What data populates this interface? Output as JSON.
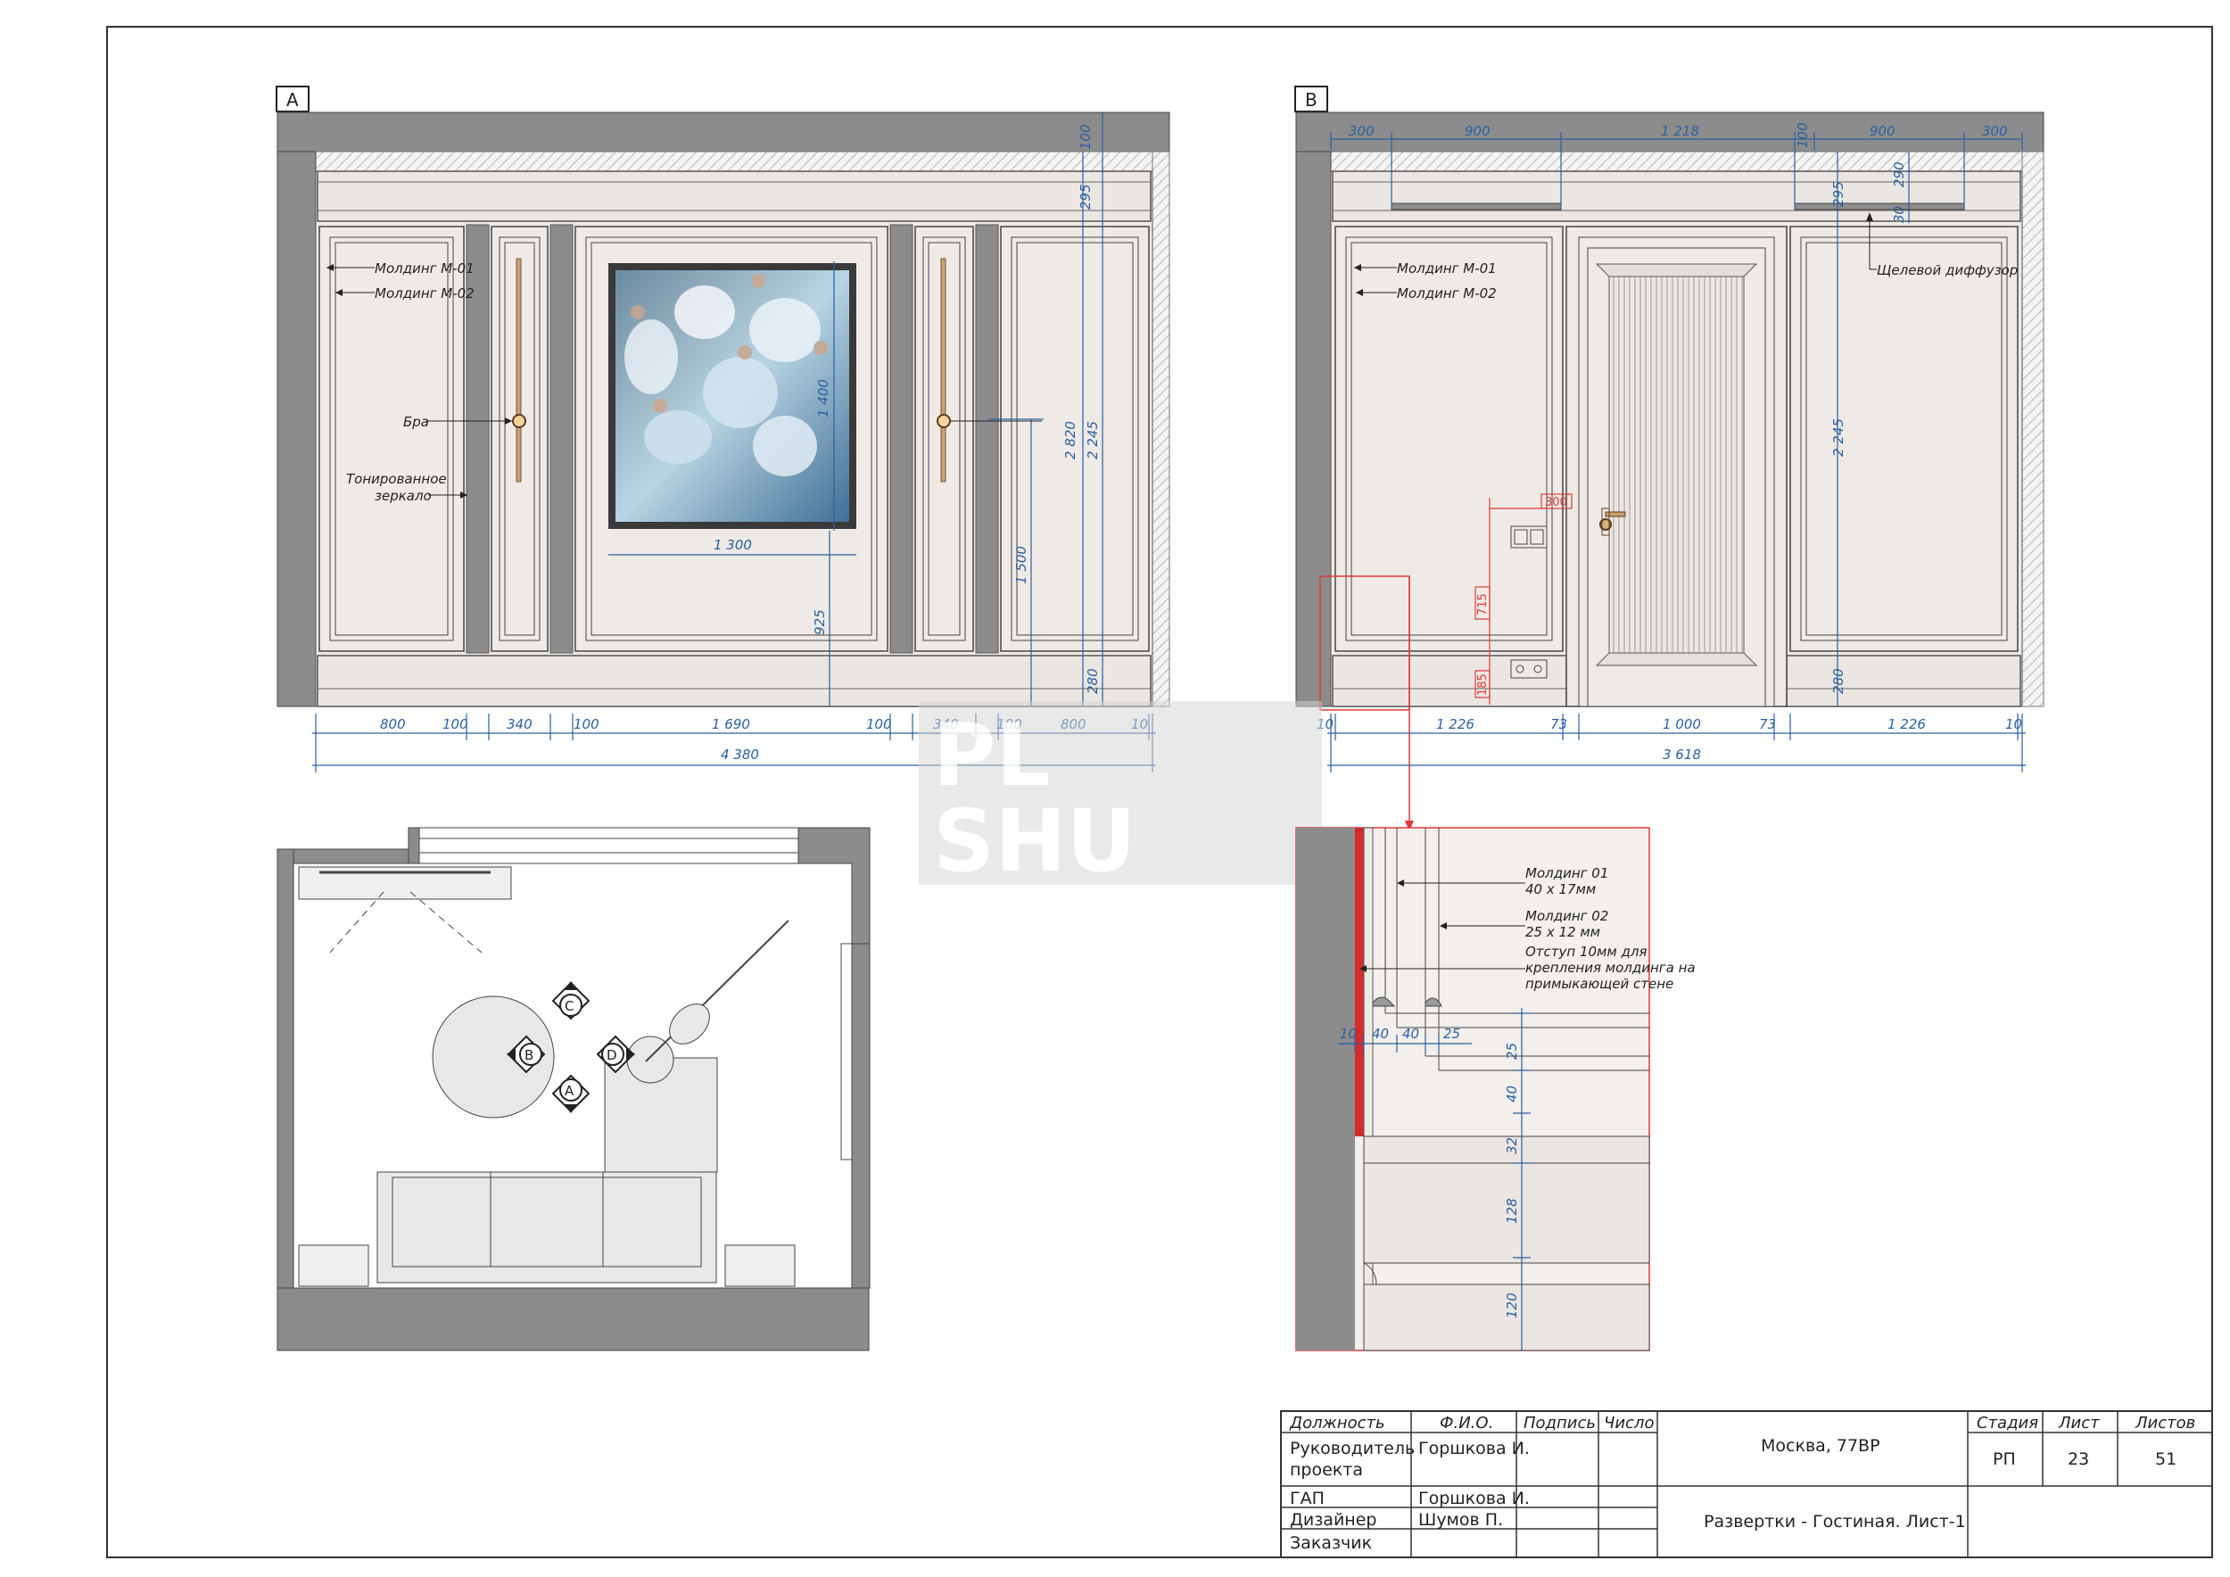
{
  "sheet": {
    "view_a_tag": "A",
    "view_b_tag": "B",
    "watermark_line1": "PL",
    "watermark_line2": "SHU"
  },
  "view_a": {
    "notes": {
      "molding_m01": "Молдинг М-01",
      "molding_m02": "Молдинг М-02",
      "sconce": "Бра",
      "mirror_line1": "Тонированное",
      "mirror_line2": "зеркало"
    },
    "dims_bottom": [
      "800",
      "100",
      "340",
      "100",
      "1 690",
      "100",
      "340",
      "100",
      "800",
      "10"
    ],
    "dim_total": "4 380",
    "dims_vertical": {
      "top_100": "100",
      "d295": "295",
      "d2820": "2 820",
      "d2245": "2 245",
      "d1400": "1 400",
      "d1500": "1 500",
      "d925": "925",
      "d280": "280",
      "d1300": "1 300"
    }
  },
  "view_b": {
    "notes": {
      "molding_m01": "Молдинг М-01",
      "molding_m02": "Молдинг М-02",
      "diffuser": "Щелевой диффузор"
    },
    "dims_top": [
      "300",
      "900",
      "1 218",
      "100",
      "900",
      "300"
    ],
    "dims_bottom": [
      "10",
      "1 226",
      "73",
      "1 000",
      "73",
      "1 226",
      "10"
    ],
    "dim_total": "3 618",
    "dims_vertical": {
      "d295": "295",
      "d290": "290",
      "d30": "30",
      "d2245": "2 245",
      "d280": "280",
      "d715": "715",
      "d185": "185",
      "d300": "300"
    }
  },
  "plan": {
    "markers": [
      "A",
      "B",
      "C",
      "D"
    ]
  },
  "detail": {
    "molding01_line1": "Молдинг 01",
    "molding01_line2": "40 х 17мм",
    "molding02_line1": "Молдинг 02",
    "molding02_line2": "25 х 12 мм",
    "offset_line1": "Отступ 10мм для",
    "offset_line2": "крепления молдинга на",
    "offset_line3": "примыкающей стене",
    "dims_horizontal": [
      "10",
      "40",
      "40",
      "25"
    ],
    "dims_vertical": [
      "25",
      "40",
      "32",
      "128",
      "120"
    ]
  },
  "title_block": {
    "headers": {
      "position": "Должность",
      "name": "Ф.И.О.",
      "signature": "Подпись",
      "date": "Число"
    },
    "rows": [
      {
        "position_line1": "Руководитель",
        "position_line2": "проекта",
        "name": "Горшкова И."
      },
      {
        "position_line1": "ГАП",
        "position_line2": "",
        "name": "Горшкова И."
      },
      {
        "position_line1": "Дизайнер",
        "position_line2": "",
        "name": "Шумов П."
      },
      {
        "position_line1": "Заказчик",
        "position_line2": "",
        "name": ""
      }
    ],
    "project": "Москва, 77ВР",
    "sheet_title": "Развертки - Гостиная. Лист-1",
    "stage_label": "Стадия",
    "sheet_label": "Лист",
    "sheets_label": "Листов",
    "stage_value": "РП",
    "sheet_value": "23",
    "sheets_value": "51"
  },
  "colors": {
    "wall_gray": "#8c8c8c",
    "panel_fill": "#efeae6",
    "dim_blue": "#2a5fa0",
    "detail_red": "#e03a3a"
  }
}
